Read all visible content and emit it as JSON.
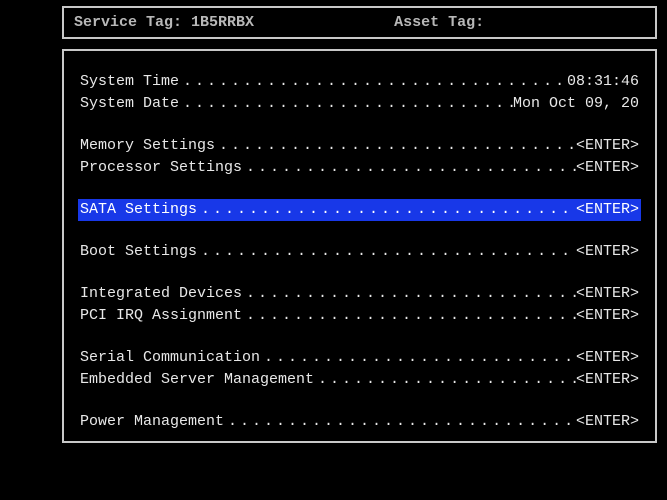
{
  "header": {
    "service_tag_label": "Service Tag:",
    "service_tag_value": "1B5RRBX",
    "asset_tag_label": "Asset Tag:",
    "asset_tag_value": ""
  },
  "rows": [
    {
      "label": "System Time",
      "value": "08:31:46",
      "interactable": "true",
      "selected": false
    },
    {
      "label": "System Date",
      "value": "Mon Oct 09, 20",
      "interactable": "true",
      "selected": false
    },
    {
      "gap": true
    },
    {
      "label": "Memory Settings",
      "value": "<ENTER>",
      "interactable": "true",
      "selected": false
    },
    {
      "label": "Processor Settings",
      "value": "<ENTER>",
      "interactable": "true",
      "selected": false
    },
    {
      "gap": true
    },
    {
      "label": "SATA Settings",
      "value": "<ENTER>",
      "interactable": "true",
      "selected": true
    },
    {
      "gap": true
    },
    {
      "label": "Boot Settings",
      "value": "<ENTER>",
      "interactable": "true",
      "selected": false
    },
    {
      "gap": true
    },
    {
      "label": "Integrated Devices",
      "value": "<ENTER>",
      "interactable": "true",
      "selected": false
    },
    {
      "label": "PCI IRQ Assignment",
      "value": "<ENTER>",
      "interactable": "true",
      "selected": false
    },
    {
      "gap": true
    },
    {
      "label": "Serial Communication",
      "value": "<ENTER>",
      "interactable": "true",
      "selected": false
    },
    {
      "label": "Embedded Server Management",
      "value": "<ENTER>",
      "interactable": "true",
      "selected": false
    },
    {
      "gap": true
    },
    {
      "label": "Power Management",
      "value": "<ENTER>",
      "interactable": "true",
      "selected": false
    }
  ]
}
